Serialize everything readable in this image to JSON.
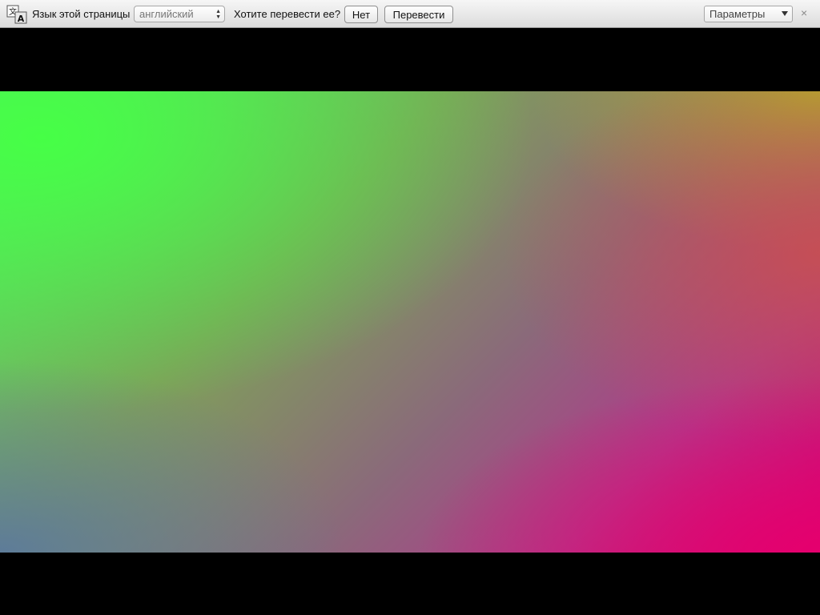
{
  "translate_bar": {
    "icon": "translate-icon",
    "language_label": "Язык этой страницы",
    "language_value": "английский",
    "question": "Хотите перевести ее?",
    "no_button": "Нет",
    "translate_button": "Перевести",
    "options_value": "Параметры",
    "close_symbol": "×"
  },
  "content": {
    "description_colors": {
      "top_left": "#4cff4c",
      "top_right": "#b0a830",
      "bottom_left": "#5a7a9a",
      "bottom_right": "#e0006a"
    }
  }
}
